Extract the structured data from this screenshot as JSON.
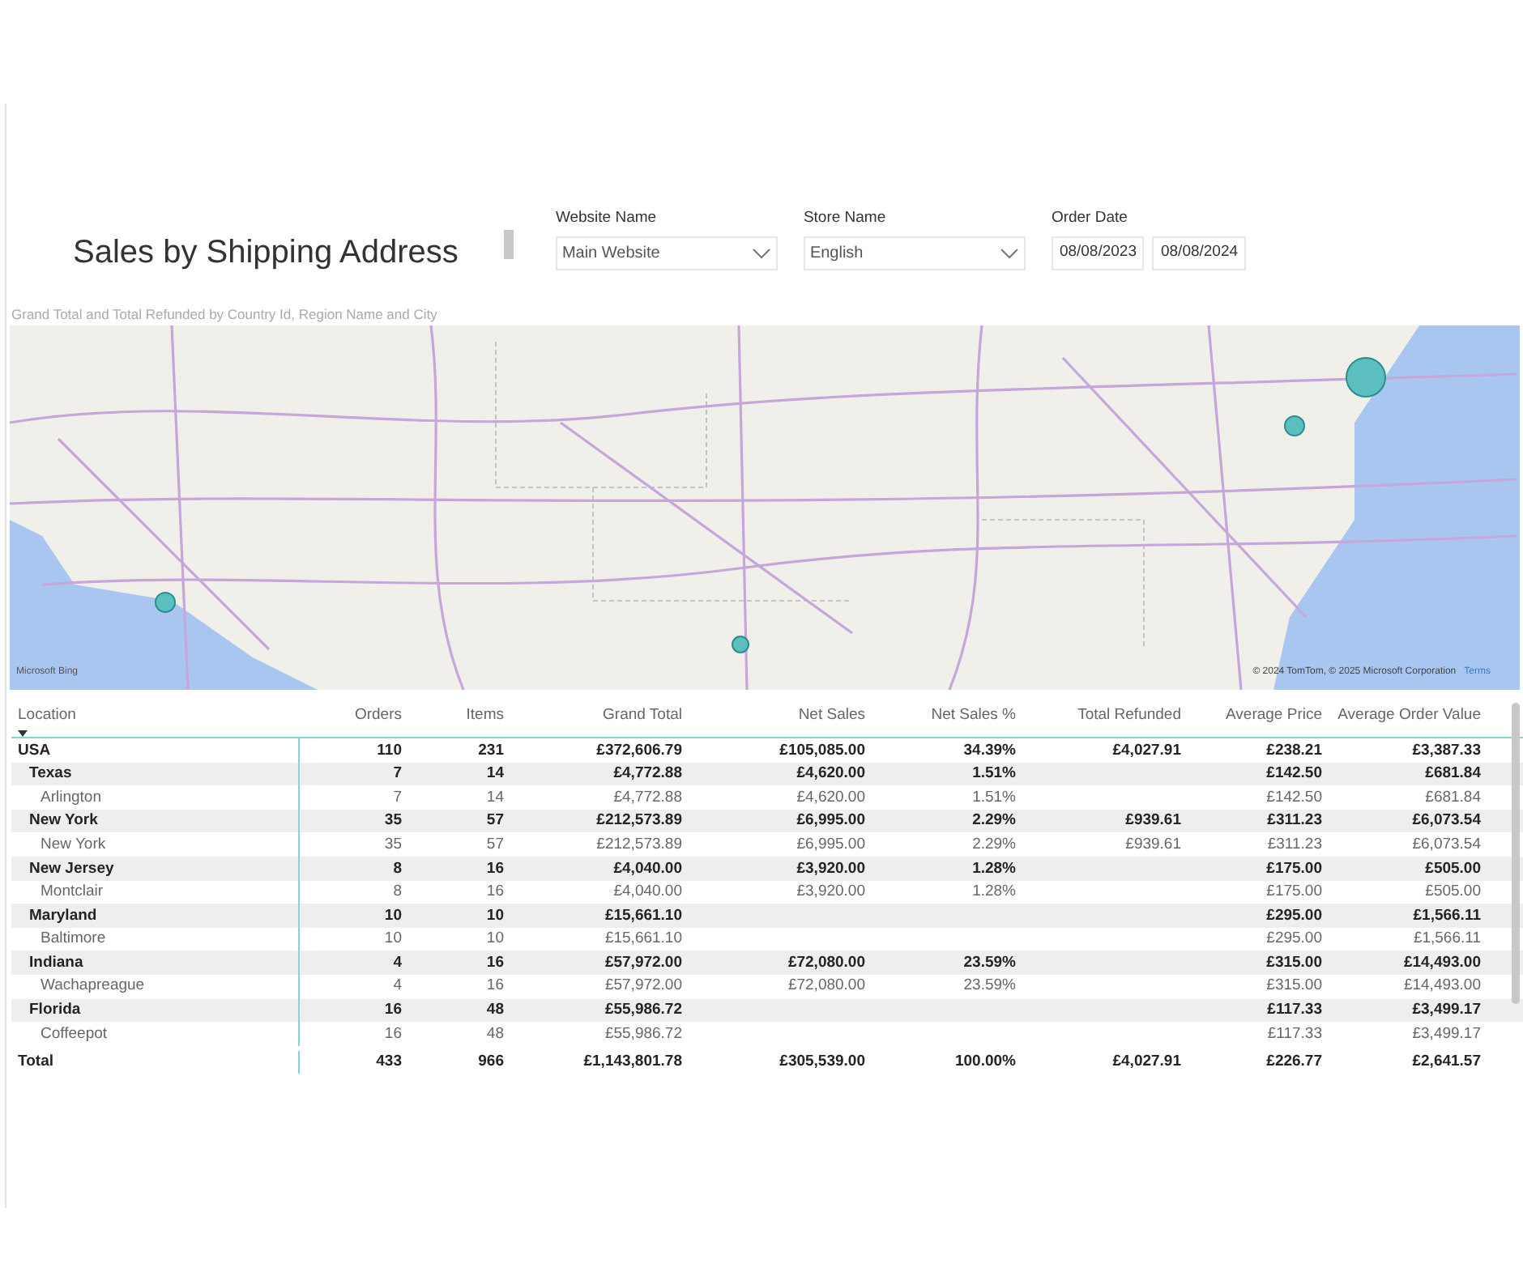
{
  "title": "Sales by Shipping Address",
  "slicers": [
    {
      "kind": "dropdown",
      "label": "Website Name",
      "value": "Main Website"
    },
    {
      "kind": "dropdown",
      "label": "Store Name",
      "value": "English"
    },
    {
      "kind": "daterange",
      "label": "Order Date",
      "start": "08/08/2023",
      "end": "08/08/2024"
    }
  ],
  "map": {
    "subtitle": "Grand Total and Total Refunded by Country Id, Region Name and City",
    "attribution": "© 2024 TomTom, © 2025 Microsoft Corporation",
    "terms": "Terms",
    "logo": "Microsoft Bing"
  },
  "table": {
    "columns": [
      "Location",
      "Orders",
      "Items",
      "Grand Total",
      "Net Sales",
      "Net Sales %",
      "Total Refunded",
      "Average Price",
      "Average Order Value"
    ],
    "rows": [
      {
        "location": "USA",
        "orders": "110",
        "items": "231",
        "grand_total": "£372,606.79",
        "net_sales": "£105,085.00",
        "net_sales_pct": "34.39%",
        "total_refunded": "£4,027.91",
        "average_price": "£238.21",
        "average_order_value": "£3,387.33",
        "children": [
          {
            "location": "Texas",
            "orders": "7",
            "items": "14",
            "grand_total": "£4,772.88",
            "net_sales": "£4,620.00",
            "net_sales_pct": "1.51%",
            "average_price": "£142.50",
            "average_order_value": "£681.84",
            "children": [
              {
                "location": "Arlington",
                "orders": "7",
                "items": "14",
                "grand_total": "£4,772.88",
                "net_sales": "£4,620.00",
                "net_sales_pct": "1.51%",
                "average_price": "£142.50",
                "average_order_value": "£681.84"
              }
            ]
          },
          {
            "location": "New York",
            "orders": "35",
            "items": "57",
            "grand_total": "£212,573.89",
            "net_sales": "£6,995.00",
            "net_sales_pct": "2.29%",
            "total_refunded": "£939.61",
            "average_price": "£311.23",
            "average_order_value": "£6,073.54",
            "children": [
              {
                "location": "New York",
                "orders": "35",
                "items": "57",
                "grand_total": "£212,573.89",
                "net_sales": "£6,995.00",
                "net_sales_pct": "2.29%",
                "total_refunded": "£939.61",
                "average_price": "£311.23",
                "average_order_value": "£6,073.54"
              }
            ]
          },
          {
            "location": "New Jersey",
            "orders": "8",
            "items": "16",
            "grand_total": "£4,040.00",
            "net_sales": "£3,920.00",
            "net_sales_pct": "1.28%",
            "average_price": "£175.00",
            "average_order_value": "£505.00",
            "children": [
              {
                "location": "Montclair",
                "orders": "8",
                "items": "16",
                "grand_total": "£4,040.00",
                "net_sales": "£3,920.00",
                "net_sales_pct": "1.28%",
                "average_price": "£175.00",
                "average_order_value": "£505.00"
              }
            ]
          },
          {
            "location": "Maryland",
            "orders": "10",
            "items": "10",
            "grand_total": "£15,661.10",
            "average_price": "£295.00",
            "average_order_value": "£1,566.11",
            "children": [
              {
                "location": "Baltimore",
                "orders": "10",
                "items": "10",
                "grand_total": "£15,661.10",
                "average_price": "£295.00",
                "average_order_value": "£1,566.11"
              }
            ]
          },
          {
            "location": "Indiana",
            "orders": "4",
            "items": "16",
            "grand_total": "£57,972.00",
            "net_sales": "£72,080.00",
            "net_sales_pct": "23.59%",
            "average_price": "£315.00",
            "average_order_value": "£14,493.00",
            "children": [
              {
                "location": "Wachapreague",
                "orders": "4",
                "items": "16",
                "grand_total": "£57,972.00",
                "net_sales": "£72,080.00",
                "net_sales_pct": "23.59%",
                "average_price": "£315.00",
                "average_order_value": "£14,493.00"
              }
            ]
          },
          {
            "location": "Florida",
            "orders": "16",
            "items": "48",
            "grand_total": "£55,986.72",
            "average_price": "£117.33",
            "average_order_value": "£3,499.17",
            "children": [
              {
                "location": "Coffeepot",
                "orders": "16",
                "items": "48",
                "grand_total": "£55,986.72",
                "average_price": "£117.33",
                "average_order_value": "£3,499.17"
              }
            ]
          }
        ]
      }
    ],
    "total": {
      "location": "Total",
      "orders": "433",
      "items": "966",
      "grand_total": "£1,143,801.78",
      "net_sales": "£305,539.00",
      "net_sales_pct": "100.00%",
      "total_refunded": "£4,027.91",
      "average_price": "£226.77",
      "average_order_value": "£2,641.57"
    }
  }
}
